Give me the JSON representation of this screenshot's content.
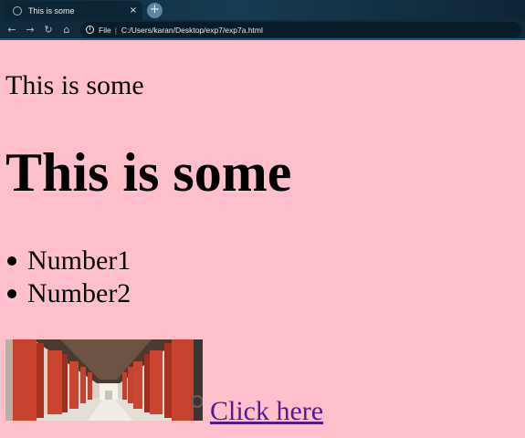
{
  "browser": {
    "tab_title": "This is some",
    "tab_close": "×",
    "new_tab": "+",
    "back": "←",
    "forward": "→",
    "reload": "↻",
    "home": "⌂",
    "info": "i",
    "file_label": "File",
    "separator": "|",
    "address": "C:/Users/karan/Desktop/exp7/exp7a.html"
  },
  "page": {
    "background": "#ffc0cb",
    "paragraph": "This is some",
    "heading": "This is some",
    "list_items": [
      "Number1",
      "Number2"
    ],
    "link_text": "Click here",
    "link_color": "#551a8b",
    "image_icon": "corridor-photo"
  }
}
